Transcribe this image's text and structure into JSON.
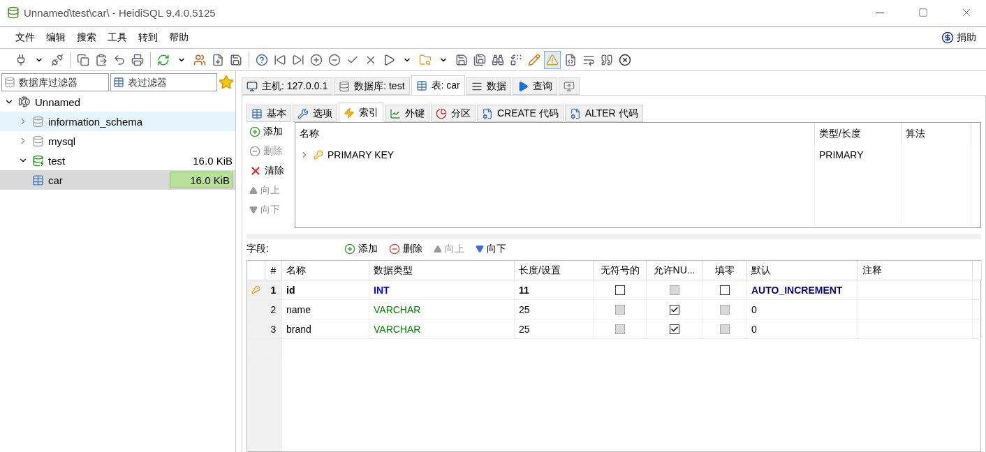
{
  "window": {
    "title": "Unnamed\\test\\car\\ - HeidiSQL 9.4.0.5125"
  },
  "menu": [
    "文件",
    "编辑",
    "搜索",
    "工具",
    "转到",
    "帮助"
  ],
  "donate": "捐助",
  "toolbar": [
    {
      "kind": "connect",
      "dropdown": true,
      "pressed": false
    },
    {
      "kind": "disconnect",
      "pressed": false
    },
    {
      "kind": "sep"
    },
    {
      "kind": "copy",
      "pressed": false
    },
    {
      "kind": "paste",
      "pressed": false
    },
    {
      "kind": "undo",
      "pressed": false
    },
    {
      "kind": "print",
      "pressed": false
    },
    {
      "kind": "sep"
    },
    {
      "kind": "refresh",
      "dropdown": true,
      "pressed": false
    },
    {
      "kind": "users",
      "pressed": false
    },
    {
      "kind": "export",
      "pressed": false
    },
    {
      "kind": "save",
      "pressed": false
    },
    {
      "kind": "sep"
    },
    {
      "kind": "help",
      "pressed": false
    },
    {
      "kind": "first",
      "pressed": false
    },
    {
      "kind": "last",
      "pressed": false
    },
    {
      "kind": "plus",
      "pressed": false
    },
    {
      "kind": "minus",
      "pressed": false
    },
    {
      "kind": "check",
      "pressed": false
    },
    {
      "kind": "cross",
      "pressed": false
    },
    {
      "kind": "run",
      "dropdown": true,
      "pressed": false
    },
    {
      "kind": "folder",
      "dropdown": true,
      "pressed": false
    },
    {
      "kind": "save",
      "pressed": false
    },
    {
      "kind": "save-as",
      "pressed": false
    },
    {
      "kind": "binoculars",
      "pressed": false
    },
    {
      "kind": "replace",
      "pressed": false
    },
    {
      "kind": "edit",
      "pressed": false
    },
    {
      "kind": "warning",
      "pressed": true
    },
    {
      "kind": "hex",
      "pressed": false
    },
    {
      "kind": "wrap",
      "pressed": false
    },
    {
      "kind": "semicolon",
      "pressed": false
    },
    {
      "kind": "stop",
      "pressed": false
    }
  ],
  "filters": {
    "database_placeholder": "数据库过滤器",
    "table_placeholder": "表过滤器"
  },
  "tree": [
    {
      "label": "Unnamed",
      "kind": "server",
      "expanded": true,
      "selected": false,
      "hovered": false,
      "children": [
        {
          "label": "information_schema",
          "kind": "database",
          "expanded": false,
          "active": false,
          "selected": false,
          "hovered": true
        },
        {
          "label": "mysql",
          "kind": "database",
          "expanded": false,
          "active": false,
          "selected": false,
          "hovered": false
        },
        {
          "label": "test",
          "kind": "database",
          "expanded": true,
          "active": true,
          "selected": false,
          "hovered": false,
          "size": "16.0 KiB",
          "children": [
            {
              "label": "car",
              "kind": "table",
              "selected": true,
              "size": "16.0 KiB",
              "level": 1
            }
          ]
        }
      ]
    }
  ],
  "main_tabs": [
    {
      "label": "主机: 127.0.0.1",
      "kind": "host",
      "selected": false
    },
    {
      "label": "数据库: test",
      "kind": "database",
      "selected": false
    },
    {
      "label": "表: car",
      "kind": "table",
      "selected": true
    },
    {
      "label": "数据",
      "kind": "data",
      "selected": false
    },
    {
      "label": "查询",
      "kind": "query",
      "selected": false
    }
  ],
  "sub_tabs": [
    {
      "label": "基本",
      "kind": "basic",
      "selected": false
    },
    {
      "label": "选项",
      "kind": "options",
      "selected": false
    },
    {
      "label": "索引",
      "kind": "indexes",
      "selected": true
    },
    {
      "label": "外键",
      "kind": "foreign",
      "selected": false
    },
    {
      "label": "分区",
      "kind": "partition",
      "selected": false
    },
    {
      "label": "CREATE 代码",
      "kind": "code",
      "selected": false
    },
    {
      "label": "ALTER 代码",
      "kind": "code",
      "selected": false
    }
  ],
  "index_actions": [
    {
      "label": "添加",
      "kind": "add",
      "disabled": false
    },
    {
      "label": "删除",
      "kind": "remove",
      "disabled": true
    },
    {
      "label": "清除",
      "kind": "clear",
      "disabled": false
    },
    {
      "label": "向上",
      "kind": "up",
      "disabled": true
    },
    {
      "label": "向下",
      "kind": "down",
      "disabled": true
    }
  ],
  "index_table": {
    "columns": [
      "名称",
      "类型/长度",
      "算法"
    ],
    "rows": [
      {
        "name": "PRIMARY KEY",
        "type": "PRIMARY",
        "expanded": false
      }
    ]
  },
  "fields_label": "字段:",
  "field_actions": [
    {
      "label": "添加",
      "kind": "add",
      "disabled": false
    },
    {
      "label": "删除",
      "kind": "remove",
      "disabled": false
    },
    {
      "label": "向上",
      "kind": "up",
      "disabled": true
    },
    {
      "label": "向下",
      "kind": "down",
      "disabled": false
    }
  ],
  "fields_table": {
    "columns": [
      "#",
      "名称",
      "数据类型",
      "长度/设置",
      "无符号的",
      "允许NU...",
      "填零",
      "默认",
      "注释"
    ],
    "rows": [
      {
        "primary_key": true,
        "number": "1",
        "name": "id",
        "type": "INT",
        "color": "#0000ff",
        "length": "11",
        "unsigned": {
          "checked": false,
          "disabled": false
        },
        "allow_null": {
          "checked": false,
          "disabled": true
        },
        "zerofill": {
          "checked": false,
          "disabled": false
        },
        "default": "AUTO_INCREMENT"
      },
      {
        "primary_key": false,
        "number": "2",
        "name": "name",
        "type": "VARCHAR",
        "color": "#008000",
        "length": "25",
        "unsigned": {
          "checked": false,
          "disabled": true
        },
        "allow_null": {
          "checked": true,
          "disabled": false
        },
        "zerofill": {
          "checked": false,
          "disabled": true
        },
        "default": "0"
      },
      {
        "primary_key": false,
        "number": "3",
        "name": "brand",
        "type": "VARCHAR",
        "color": "#008000",
        "length": "25",
        "unsigned": {
          "checked": false,
          "disabled": true
        },
        "allow_null": {
          "checked": true,
          "disabled": false
        },
        "zerofill": {
          "checked": false,
          "disabled": true
        },
        "default": "0"
      }
    ]
  }
}
